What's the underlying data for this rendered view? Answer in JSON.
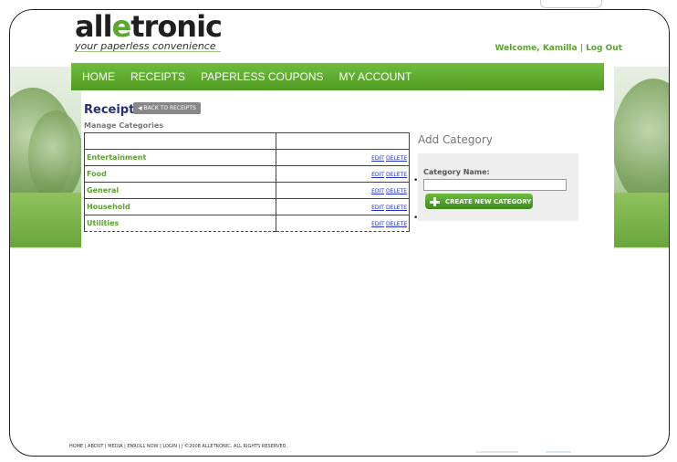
{
  "brand": {
    "prefix": "all",
    "middle": "e",
    "suffix": "tronic",
    "tagline": "your paperless convenience"
  },
  "header": {
    "welcome": "Welcome, Kamilla | Log Out"
  },
  "nav": {
    "items": [
      "HOME",
      "RECEIPTS",
      "PAPERLESS COUPONS",
      "MY ACCOUNT"
    ]
  },
  "page": {
    "title": "Receipts",
    "back_label": "◀ BACK TO RECEIPTS",
    "subtitle": "Manage Categories"
  },
  "categories": [
    {
      "name": "Entertainment",
      "edit": "EDIT",
      "delete": "DELETE"
    },
    {
      "name": "Food",
      "edit": "EDIT",
      "delete": "DELETE"
    },
    {
      "name": "General",
      "edit": "EDIT",
      "delete": "DELETE"
    },
    {
      "name": "Household",
      "edit": "EDIT",
      "delete": "DELETE"
    },
    {
      "name": "Utilities",
      "edit": "EDIT",
      "delete": "DELETE"
    }
  ],
  "add_category": {
    "title": "Add Category",
    "label": "Category Name:",
    "input_value": "",
    "button_label": "CREATE NEW CATEGORY"
  },
  "footer": {
    "text": "HOME | ABOUT | MEDIA | ENROLL NOW | LOGIN | | ©2008 ALLETRONIC. ALL RIGHTS RESERVED."
  },
  "colors": {
    "brand_green": "#55aa2f",
    "nav_green": "#5aa32e",
    "title_blue": "#24307a",
    "link_blue": "#2233cc"
  }
}
